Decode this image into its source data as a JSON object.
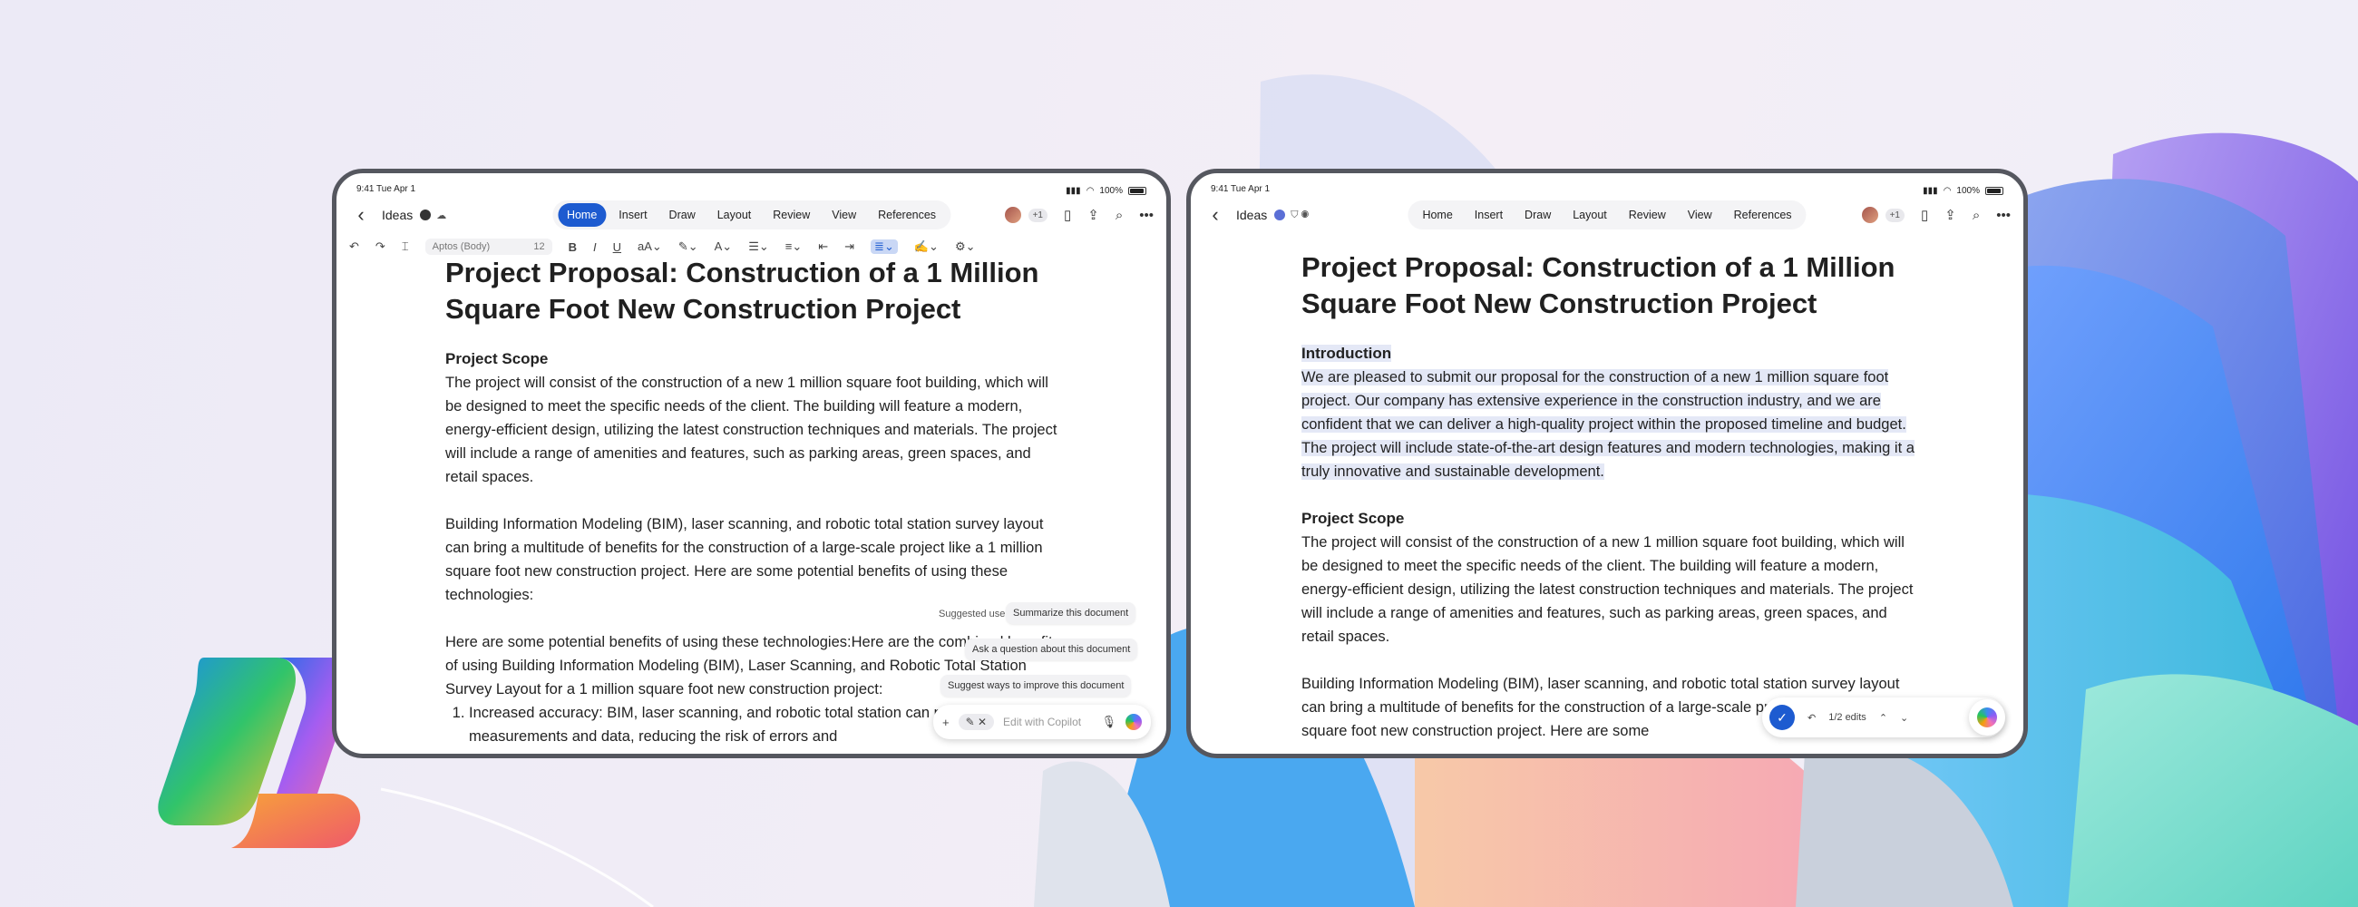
{
  "colors": {
    "accent": "#1d5bd0",
    "highlight": "#e4e8f6",
    "frame": "#55575f"
  },
  "left_tablet": {
    "status": {
      "time": "9:41  Tue Apr 1",
      "battery": "100%"
    },
    "nav": {
      "back_icon": "chevron-left-icon",
      "doc_name": "Ideas",
      "tabs": [
        "Home",
        "Insert",
        "Draw",
        "Layout",
        "Review",
        "View",
        "References"
      ],
      "active_tab": "Home",
      "collab_count": "+1"
    },
    "ribbon": {
      "font_name": "Aptos (Body)",
      "font_size": "12"
    },
    "doc": {
      "title": "Project Proposal: Construction of a 1 Million Square Foot New Construction Project",
      "scope_heading": "Project Scope",
      "scope_text": "The project will consist of the construction of a new 1 million square foot building, which will be designed to meet the specific needs of the client. The building will feature a modern, energy-efficient design, utilizing the latest construction techniques and materials. The project will include a range of amenities and features, such as parking areas, green spaces, and retail spaces.",
      "bim_text": "Building Information Modeling (BIM), laser scanning, and robotic total station survey layout can bring a multitude of benefits for the construction of a large-scale project like a 1 million square foot new construction project. Here are some potential benefits of using these technologies:",
      "benefits_text": "Here are some potential benefits of using these technologies:Here are the combined benefits of using Building Information Modeling (BIM), Laser Scanning, and Robotic Total Station Survey Layout for a 1 million square foot new construction project:",
      "list_items": [
        "Increased accuracy: BIM, laser scanning, and robotic total station can provide accurate measurements and data, reducing the risk of errors and"
      ]
    },
    "copilot": {
      "suggested_label": "Suggested use",
      "suggestions": [
        "Summarize this document",
        "Ask a question about this document",
        "Suggest ways to improve this document"
      ],
      "placeholder": "Edit with Copilot"
    }
  },
  "right_tablet": {
    "status": {
      "time": "9:41  Tue Apr 1",
      "battery": "100%"
    },
    "nav": {
      "doc_name": "Ideas",
      "tabs": [
        "Home",
        "Insert",
        "Draw",
        "Layout",
        "Review",
        "View",
        "References"
      ],
      "collab_count": "+1"
    },
    "doc": {
      "title": "Project Proposal: Construction of a 1 Million Square Foot New Construction Project",
      "intro_heading": "Introduction",
      "intro_text": "We are pleased to submit our proposal for the construction of a new 1 million square foot project. Our company has extensive experience in the construction industry, and we are confident that we can deliver a high-quality project within the proposed timeline and budget. The project will include state-of-the-art design features and modern technologies, making it a truly innovative and sustainable development.",
      "scope_heading": "Project Scope",
      "scope_text": "The project will consist of the construction of a new 1 million square foot building, which will be designed to meet the specific needs of the client. The building will feature a modern, energy-efficient design, utilizing the latest construction techniques and materials. The project will include a range of amenities and features, such as parking areas, green spaces, and retail spaces.",
      "bim_text": "Building Information Modeling (BIM), laser scanning, and robotic total station survey layout can bring a multitude of benefits for the construction of a large-scale project like a 1 million square foot new construction project. Here are some"
    },
    "edits": {
      "counter": "1/2 edits"
    }
  }
}
